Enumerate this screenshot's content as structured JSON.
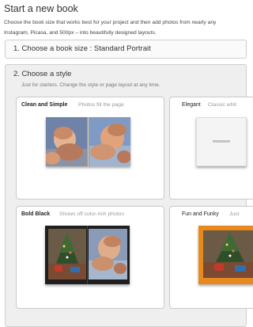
{
  "page": {
    "title": "Start a new book",
    "intro_line1": "Choose the book size that works best for your project and then add photos from nearly any",
    "intro_line2": "Instagram, Picasa, and 500px – into beautifully designed layouts."
  },
  "step1": {
    "label": "1. Choose a book size : Standard Portrait"
  },
  "step2": {
    "label": "2. Choose a style",
    "subtitle": "Just for starters. Change the style or page layout at any time.",
    "styles": [
      {
        "name": "Clean and Simple",
        "description": "Photos fill the page"
      },
      {
        "name": "Elegant",
        "description": "Classic whit"
      },
      {
        "name": "Bold Black",
        "description": "Shows off color-rich photos"
      },
      {
        "name": "Fun and Funky",
        "description": "Just"
      }
    ]
  },
  "colors": {
    "panel_bg": "#efefef",
    "card_border": "#c9c9c9",
    "funky_orange": "#e8891e",
    "bold_black": "#1f1f1f"
  }
}
